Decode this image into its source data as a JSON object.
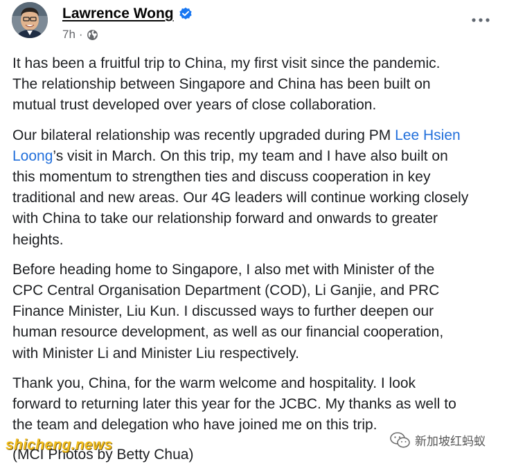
{
  "post": {
    "author_name": "Lawrence Wong",
    "timestamp": "7h",
    "separator": "·",
    "audience_icon": "globe-icon",
    "more_icon": "more-options-icon",
    "verified_icon": "verified-badge-icon",
    "mention_color": "#216fdb",
    "paragraphs": {
      "p1": {
        "l1": "It has been a fruitful trip to China, my first visit since the pandemic.",
        "l2": "The relationship between Singapore and China has been built on",
        "l3": "mutual trust developed over years of close collaboration."
      },
      "p2": {
        "l1a": "Our bilateral relationship was recently upgraded during PM ",
        "mention": "Lee Hsien Loong",
        "mention_part1": "Lee Hsien",
        "mention_part2": "Loong",
        "l2b": "’s visit in March. On this trip, my team and I have also built on",
        "l3": "this momentum to strengthen ties and discuss cooperation in key",
        "l4": "traditional and new areas. Our 4G leaders will continue working closely",
        "l5": "with China to take our relationship forward and onwards to greater",
        "l6": "heights."
      },
      "p3": {
        "l1": "Before heading home to Singapore, I also met with Minister of the",
        "l2": "CPC Central Organisation Department (COD), Li Ganjie, and PRC",
        "l3": "Finance Minister, Liu Kun. I discussed ways to further deepen our",
        "l4": "human resource development, as well as our financial cooperation,",
        "l5": "with Minister Li and Minister Liu respectively."
      },
      "p4": {
        "l1": "Thank you, China, for the warm welcome and hospitality. I look",
        "l2": "forward to returning later this year for the JCBC. My thanks as well to",
        "l3": "the team and delegation who have joined me on this trip."
      },
      "p5": {
        "l1": "(MCI Photos by Betty Chua)"
      }
    }
  },
  "watermarks": {
    "left_text": "shicheng.news",
    "right_text": "新加坡红蚂蚁",
    "right_icon": "wechat-icon"
  }
}
